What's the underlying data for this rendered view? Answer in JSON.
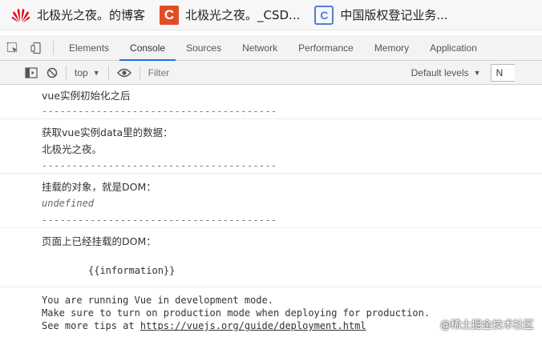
{
  "bookmarks": [
    {
      "label": "北极光之夜。的博客",
      "icon": "huawei-icon"
    },
    {
      "label": "北极光之夜。_CSD...",
      "icon": "csdn-icon",
      "glyph": "C"
    },
    {
      "label": "中国版权登记业务...",
      "icon": "copyright-icon",
      "glyph": "C"
    }
  ],
  "devtools": {
    "tabs": [
      "Elements",
      "Console",
      "Sources",
      "Network",
      "Performance",
      "Memory",
      "Application"
    ],
    "active_tab": "Console"
  },
  "console_toolbar": {
    "context": "top",
    "filter_placeholder": "Filter",
    "levels": "Default levels",
    "partial_box": "N"
  },
  "console_lines": {
    "l1": "vue实例初始化之后",
    "d1": "---------------------------------------",
    "l2": "获取vue实例data里的数据：",
    "l3": "北极光之夜。",
    "d2": "---------------------------------------",
    "l4": "挂载的对象，就是DOM：",
    "l5": "undefined",
    "d3": "---------------------------------------",
    "l6": "页面上已经挂载的DOM：",
    "l7": "{{information}}",
    "l8": "You are running Vue in development mode.",
    "l9": "Make sure to turn on production mode when deploying for production.",
    "l10_prefix": "See more tips at ",
    "l10_link": "https://vuejs.org/guide/deployment.html"
  },
  "watermark": "@稀土掘金技术社区"
}
